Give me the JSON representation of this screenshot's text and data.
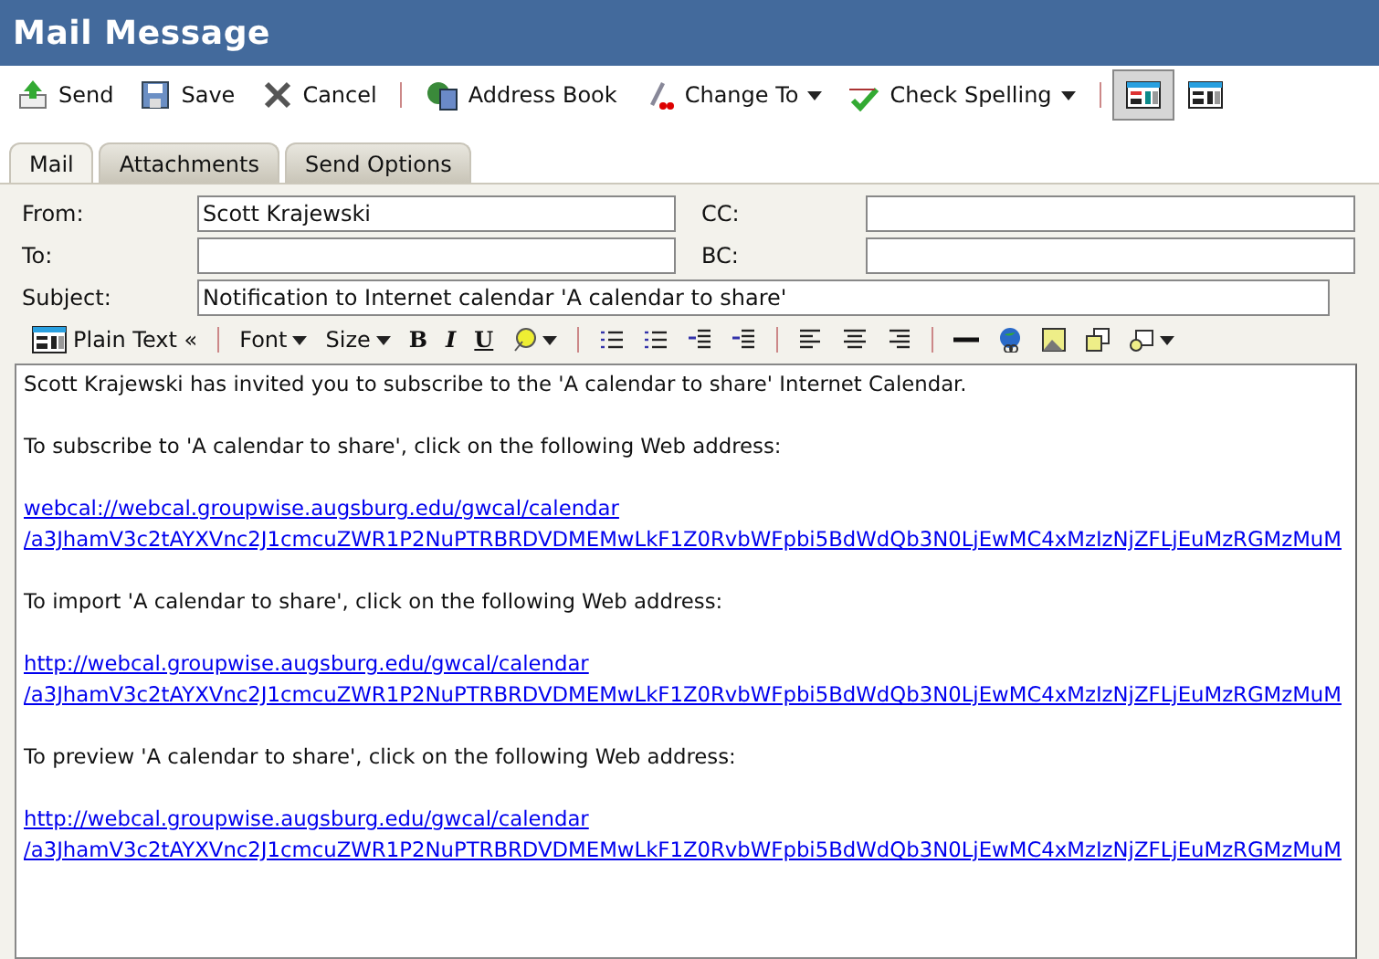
{
  "window": {
    "title": "Mail Message"
  },
  "toolbar": [
    {
      "kind": "button",
      "label": "Send"
    },
    {
      "kind": "button",
      "label": "Save"
    },
    {
      "kind": "button",
      "label": "Cancel"
    },
    {
      "kind": "separator"
    },
    {
      "kind": "button",
      "label": "Address Book"
    },
    {
      "kind": "menu",
      "label": "Change To"
    },
    {
      "kind": "menu",
      "label": "Check Spelling"
    },
    {
      "kind": "separator"
    },
    {
      "kind": "view",
      "selected": true
    },
    {
      "kind": "view",
      "selected": false
    }
  ],
  "tabs": [
    {
      "label": "Mail",
      "selected": true
    },
    {
      "label": "Attachments",
      "selected": false
    },
    {
      "label": "Send Options",
      "selected": false
    }
  ],
  "fields": {
    "from": {
      "label": "From:",
      "value": "Scott Krajewski"
    },
    "to": {
      "label": "To:"
    },
    "cc": {
      "label": "CC:"
    },
    "bc": {
      "label": "BC:"
    },
    "subject": {
      "label": "Subject:",
      "value": "Notification to Internet calendar 'A calendar to share'"
    }
  },
  "format_toolbar": {
    "mode": "Plain Text «",
    "font": "Font",
    "size": "Size",
    "bold": "B",
    "italic": "I",
    "underline": "U"
  },
  "body": [
    {
      "kind": "text",
      "text": "Scott Krajewski has invited you to subscribe to the 'A calendar to share' Internet Calendar."
    },
    {
      "kind": "text",
      "text": "To subscribe to 'A calendar to share', click on the following Web address:"
    },
    {
      "kind": "link",
      "lines": [
        "webcal://webcal.groupwise.augsburg.edu/gwcal/calendar",
        "/a3JhamV3c2tAYXVnc2J1cmcuZWR1P2NuPTRBRDVDMEMwLkF1Z0RvbWFpbi5BdWdQb3N0LjEwMC4xMzIzNjZFLjEuMzRGMzMuM"
      ]
    },
    {
      "kind": "text",
      "text": "To import 'A calendar to share', click on the following Web address:"
    },
    {
      "kind": "link",
      "lines": [
        "http://webcal.groupwise.augsburg.edu/gwcal/calendar",
        "/a3JhamV3c2tAYXVnc2J1cmcuZWR1P2NuPTRBRDVDMEMwLkF1Z0RvbWFpbi5BdWdQb3N0LjEwMC4xMzIzNjZFLjEuMzRGMzMuM"
      ]
    },
    {
      "kind": "text",
      "text": "To preview 'A calendar to share', click on the following Web address:"
    },
    {
      "kind": "link",
      "lines": [
        "http://webcal.groupwise.augsburg.edu/gwcal/calendar",
        "/a3JhamV3c2tAYXVnc2J1cmcuZWR1P2NuPTRBRDVDMEMwLkF1Z0RvbWFpbi5BdWdQb3N0LjEwMC4xMzIzNjZFLjEuMzRGMzMuM"
      ]
    }
  ]
}
